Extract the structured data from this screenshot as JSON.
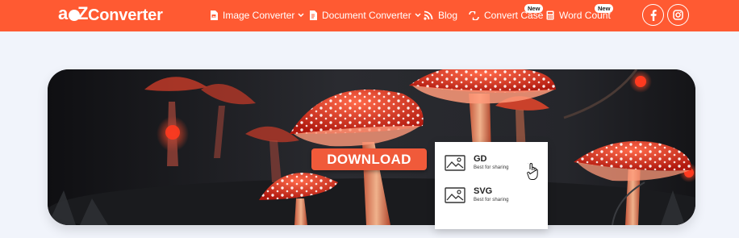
{
  "header": {
    "logo": {
      "mark": "a2z",
      "text": "Converter"
    },
    "nav": [
      {
        "label": "Image Converter",
        "icon": "image-file-icon",
        "dropdown": true
      },
      {
        "label": "Document Converter",
        "icon": "document-file-icon",
        "dropdown": true
      },
      {
        "label": "Blog",
        "icon": "rss-icon",
        "dropdown": false
      },
      {
        "label": "Convert Case",
        "icon": "convert-case-icon",
        "dropdown": false,
        "badge": "New"
      },
      {
        "label": "Word Count",
        "icon": "calculator-icon",
        "dropdown": false,
        "badge": "New"
      }
    ],
    "social": [
      {
        "icon": "facebook-icon"
      },
      {
        "icon": "instagram-icon"
      }
    ]
  },
  "banner": {
    "download_label": "DOWNLOAD",
    "dropdown": [
      {
        "title": "GD",
        "subtitle": "Best for sharing",
        "icon": "image-icon"
      },
      {
        "title": "SVG",
        "subtitle": "Best for sharing",
        "icon": "image-icon"
      }
    ]
  },
  "colors": {
    "header_bg": "#ff5a32",
    "page_bg": "#f1f4fb",
    "download_bg": "#f05a3a"
  }
}
